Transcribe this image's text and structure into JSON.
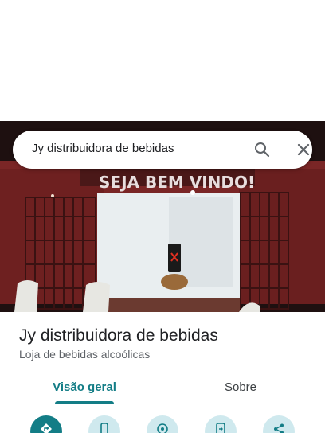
{
  "search": {
    "query": "Jy distribuidora de bebidas",
    "search_icon": "search-icon",
    "close_icon": "close-icon"
  },
  "hero_photo": {
    "sign_text": "SEJA BEM VINDO!"
  },
  "place": {
    "title": "Jy distribuidora de bebidas",
    "category": "Loja de bebidas alcoólicas"
  },
  "tabs": [
    {
      "label": "Visão geral",
      "selected": true
    },
    {
      "label": "Sobre",
      "selected": false
    }
  ],
  "actions": [
    {
      "icon": "directions-icon",
      "primary": true
    },
    {
      "icon": "phone-icon",
      "primary": false
    },
    {
      "icon": "nearby-icon",
      "primary": false
    },
    {
      "icon": "send-to-phone-icon",
      "primary": false
    },
    {
      "icon": "share-icon",
      "primary": false
    }
  ],
  "colors": {
    "accent": "#137d86",
    "action_bg": "#cfe9ee",
    "wall_red": "#7a2626"
  }
}
